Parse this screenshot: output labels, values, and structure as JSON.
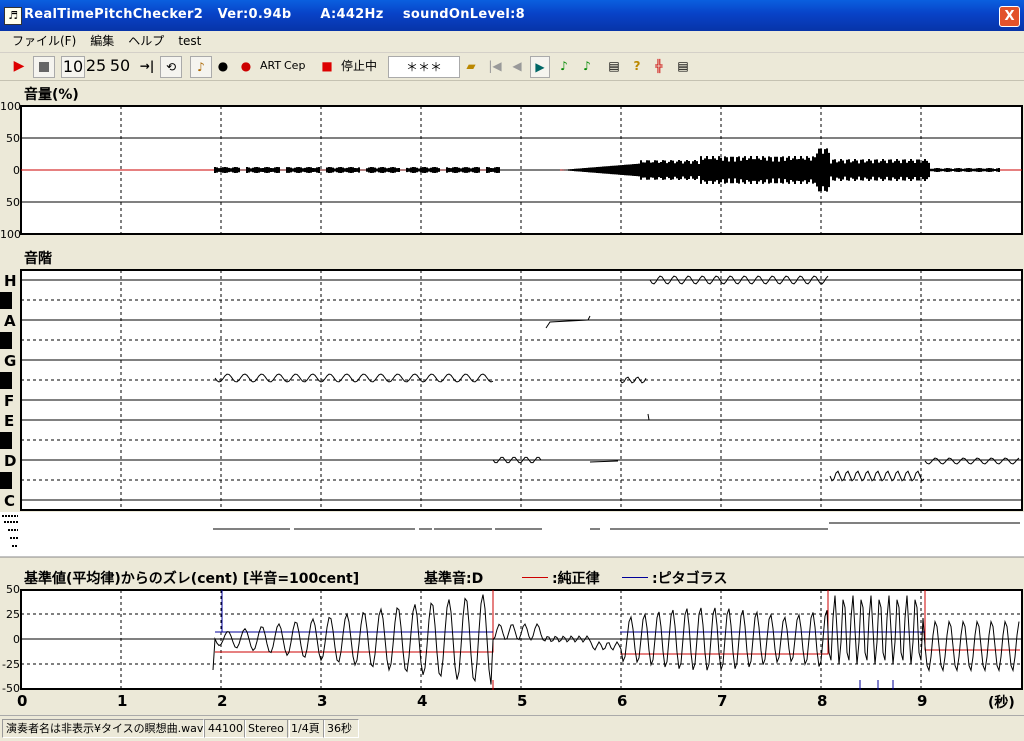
{
  "window": {
    "title": "RealTimePitchChecker2   Ver:0.94b      A:442Hz    soundOnLevel:8",
    "close_label": "X"
  },
  "menu": [
    "ファイル(F)",
    "編集",
    "ヘルプ",
    "test"
  ],
  "toolbar": {
    "zoom_10": "10",
    "zoom_25": "25",
    "zoom_50": "50",
    "art_label": "ART",
    "cep_label": "Cep",
    "status_text": "停止中",
    "note_display": "＊＊＊"
  },
  "volume_panel": {
    "title": "音量(%)",
    "ticks": [
      "100",
      "50",
      "0",
      "50",
      "100"
    ]
  },
  "scale_panel": {
    "title": "音階",
    "notes": [
      "H",
      "A",
      "G",
      "F",
      "E",
      "D",
      "C"
    ]
  },
  "deviation_panel": {
    "title": "基準値(平均律)からのズレ(cent) [半音=100cent]",
    "base_note": "基準音:D",
    "legend": [
      {
        "label": ":純正律",
        "color": "#CC0000"
      },
      {
        "label": ":ピタゴラス",
        "color": "#000099"
      }
    ],
    "ticks": [
      "50",
      "25",
      "0",
      "-25",
      "-50"
    ]
  },
  "time_axis": {
    "labels": [
      "0",
      "1",
      "2",
      "3",
      "4",
      "5",
      "6",
      "7",
      "8",
      "9"
    ],
    "unit": "(秒)"
  },
  "statusbar": {
    "file": "演奏者名は非表示¥タイスの瞑想曲.wav",
    "rate": "44100",
    "channels": "Stereo",
    "page": "1/4頁",
    "duration": "36秒"
  }
}
